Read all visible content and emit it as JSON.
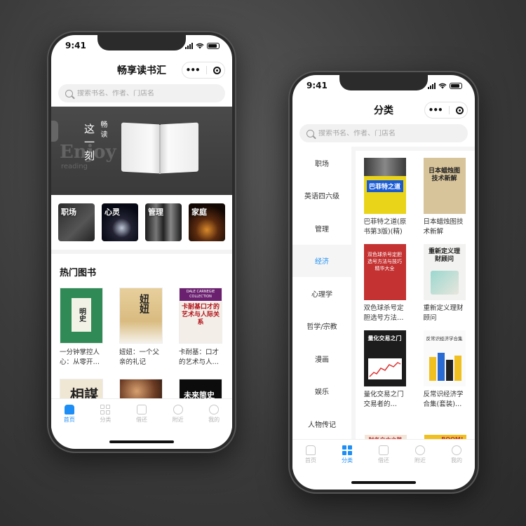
{
  "phone1": {
    "status_time": "9:41",
    "nav_title": "畅享读书汇",
    "search_placeholder": "搜索书名、作者、门店名",
    "banner": {
      "vertical_main": "这一刻",
      "vertical_sub": "畅读",
      "watermark_big": "Enjoy",
      "watermark_small": "reading"
    },
    "categories": [
      {
        "label": "职场"
      },
      {
        "label": "心灵"
      },
      {
        "label": "管理"
      },
      {
        "label": "家庭"
      }
    ],
    "section_title": "热门图书",
    "books_row1": [
      {
        "title": "一分钟掌控人心：从零开…",
        "cover_text": "明史"
      },
      {
        "title": "妞妞：一个父亲的礼记",
        "cover_text": "妞妞"
      },
      {
        "title": "卡耐基：口才的艺术与人…",
        "cover_band": "DALE CARNEGIE COLLECTION",
        "cover_text": "卡耐基口才的艺术与人际关系"
      }
    ],
    "books_row2": [
      {
        "cover_text": "相謀"
      },
      {
        "cover_text": ""
      },
      {
        "cover_text": "未来简史"
      }
    ],
    "tabs": [
      {
        "label": "首页",
        "icon": "home-icon",
        "active": true
      },
      {
        "label": "分类",
        "icon": "grid-icon",
        "active": false
      },
      {
        "label": "借还",
        "icon": "borrow-icon",
        "active": false
      },
      {
        "label": "附近",
        "icon": "compass-icon",
        "active": false
      },
      {
        "label": "我的",
        "icon": "profile-icon",
        "active": false
      }
    ]
  },
  "phone2": {
    "status_time": "9:41",
    "nav_title": "分类",
    "search_placeholder": "搜索书名、作者、门店名",
    "side_items": [
      {
        "label": "职场",
        "active": false
      },
      {
        "label": "英语四六级",
        "active": false
      },
      {
        "label": "管理",
        "active": false
      },
      {
        "label": "经济",
        "active": true
      },
      {
        "label": "心理学",
        "active": false
      },
      {
        "label": "哲学/宗教",
        "active": false
      },
      {
        "label": "漫画",
        "active": false
      },
      {
        "label": "娱乐",
        "active": false
      },
      {
        "label": "人物传记",
        "active": false
      }
    ],
    "books": [
      {
        "title": "巴菲特之道(原书第3版)(精)",
        "cover_text": "巴菲特之道"
      },
      {
        "title": "日本蜡烛图技术新解",
        "cover_text": "日本蜡烛图技术新解"
      },
      {
        "title": "双色球杀号定胆选号方法…",
        "cover_text": "双色球杀号定胆选号方法与技巧精华大全"
      },
      {
        "title": "重新定义理财顾问",
        "cover_text": "重新定义理财顾问"
      },
      {
        "title": "量化交易之门交易者的…",
        "cover_text": "量化交易之门"
      },
      {
        "title": "反常识经济学合集(套装)…",
        "cover_text": "反常识经济学合集"
      }
    ],
    "partial_covers": [
      {
        "cover_text": "财务自由之路"
      },
      {
        "cover_text": "BOOM!"
      }
    ],
    "tabs": [
      {
        "label": "首页",
        "icon": "home-icon",
        "active": false
      },
      {
        "label": "分类",
        "icon": "grid-icon",
        "active": true
      },
      {
        "label": "借还",
        "icon": "borrow-icon",
        "active": false
      },
      {
        "label": "附近",
        "icon": "compass-icon",
        "active": false
      },
      {
        "label": "我的",
        "icon": "profile-icon",
        "active": false
      }
    ]
  },
  "colors": {
    "accent": "#1d8ef5",
    "tab_inactive": "#b5b5b5",
    "search_bg": "#f1f1f1"
  }
}
